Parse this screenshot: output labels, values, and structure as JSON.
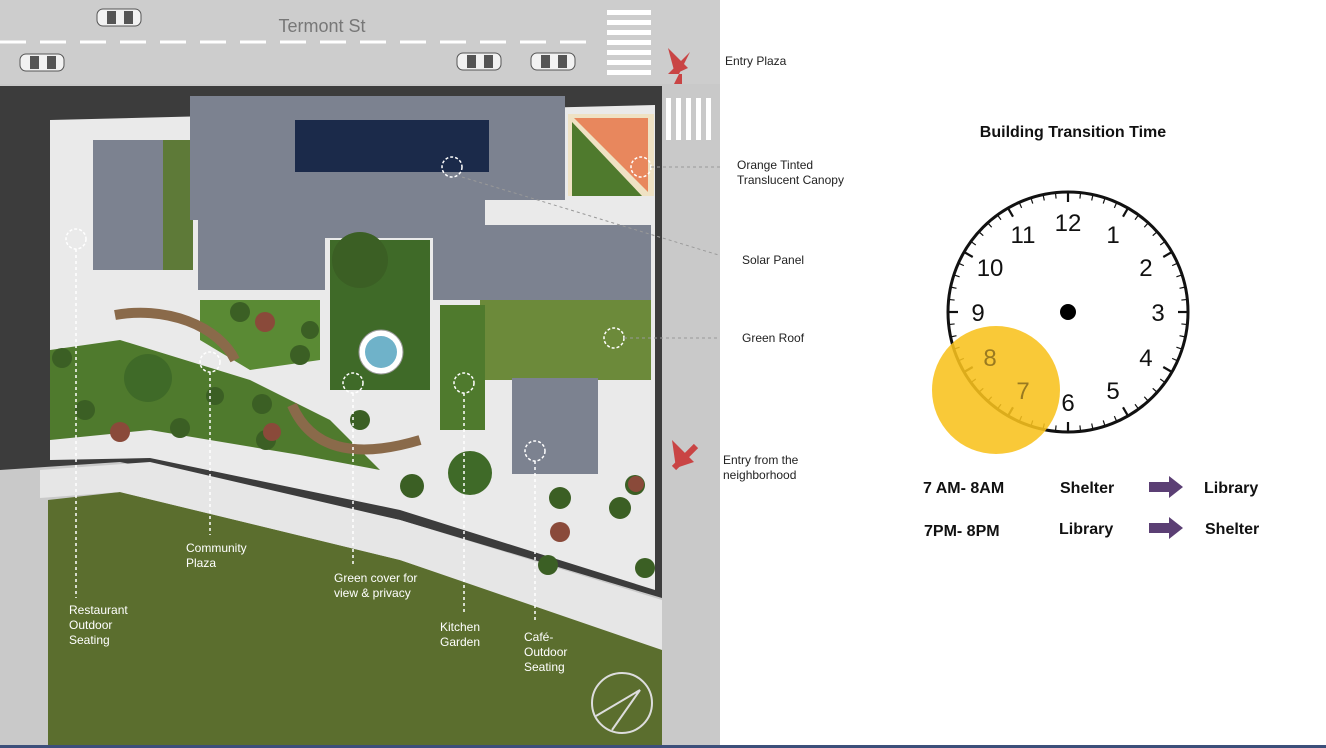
{
  "street_name": "Termont St",
  "callouts": {
    "entry_plaza": "Entry Plaza",
    "canopy": [
      "Orange Tinted",
      "Translucent Canopy"
    ],
    "solar_panel": "Solar Panel",
    "green_roof": "Green Roof",
    "entry_neighborhood": [
      "Entry from the",
      "neighborhood"
    ]
  },
  "map_labels": {
    "restaurant": [
      "Restaurant",
      "Outdoor",
      "Seating"
    ],
    "community": [
      "Community",
      "Plaza"
    ],
    "green_cover": [
      "Green cover  for",
      "view &   privacy"
    ],
    "kitchen": [
      "Kitchen",
      "Garden"
    ],
    "cafe": [
      "Café-",
      "Outdoor",
      "Seating"
    ]
  },
  "colors": {
    "road": "#c9c9c9",
    "pavement": "#eaeaea",
    "roof": "#7c8290",
    "grass": "#4f7a2d",
    "lawn": "#5b6e2e",
    "canopy": "#e8875d",
    "arrow_red": "#c94444",
    "clock_highlight": "#f8c21c",
    "schedule_arrow": "#5b3f74"
  },
  "chart_data": {
    "type": "clock",
    "title": "Building Transition Time",
    "hour_labels": [
      "12",
      "1",
      "2",
      "3",
      "4",
      "5",
      "6",
      "7",
      "8",
      "9",
      "10",
      "11"
    ],
    "highlighted_hours": [
      7,
      8
    ],
    "schedule": [
      {
        "time": "7 AM- 8AM",
        "from": "Shelter",
        "to": "Library"
      },
      {
        "time": "7PM- 8PM",
        "from": "Library",
        "to": "Shelter"
      }
    ]
  }
}
